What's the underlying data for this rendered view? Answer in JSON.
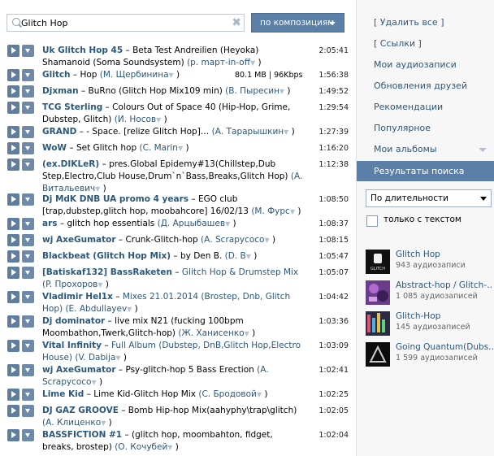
{
  "search": {
    "value": "Glitch Hop",
    "sort_label": "по композициям"
  },
  "tracks": [
    {
      "html": "<b>Uk Glitch Hop 45</b> – Beta Test Andreilien (Heyoka) Shamanoid (Soma Soundsystem) <span class=\"u\">(р. mapт-in-off</span><span class=\"dd\">▼</span> )",
      "dur": "2:05:41"
    },
    {
      "html": "<b>Glitch</b> – Hop <span class=\"u\">(М. Щербинина</span><span class=\"dd\">▼</span> )",
      "dur": "1:56:38",
      "meta": "80.1 MB | 96Kbps"
    },
    {
      "html": "<b>Djxman</b> – BuRno (Glitch Hop Mix109 min) <span class=\"u\">(В. Пыресин</span><span class=\"dd\">▼</span> )",
      "dur": "1:49:52"
    },
    {
      "html": "<b>TCG Sterling</b> – Colours Out of Space 40 (Hip-Hop, Grime, Dubstep, Glitch) <span class=\"u\">(И. Носов</span><span class=\"dd\">▼</span> )",
      "dur": "1:29:54"
    },
    {
      "html": "<b>GRAND</b> – - Space. [relize Glitch Hop]… <span class=\"u\">(А. Тарарышкин</span><span class=\"dd\">▼</span> )",
      "dur": "1:27:39"
    },
    {
      "html": "<b>WoW</b> – Set Glitch hop <span class=\"u\">(С. Marin</span><span class=\"dd\">▼</span> )",
      "dur": "1:16:20"
    },
    {
      "html": "<b>(ex.DIKLeR)</b> – pres.Global Epidemy#13(Chillstep,Dub Step,Electro,Club House,Drum`n`Bass,Breaks,Glitch Hop) <span class=\"u\">(А. Витальевич</span><span class=\"dd\">▼</span> )",
      "dur": "1:12:38"
    },
    {
      "html": "<b>Dj MdK DNB UA promo 4 years</b> – EGO club [trap,dubstep,glitch hop, moobahcore] 16/02/13 <span class=\"u\">(М. Фурс</span><span class=\"dd\">▼</span> )",
      "dur": "1:08:50"
    },
    {
      "html": "<b>ars</b> – glitch hop essentials <span class=\"u\">(Д. Арцыбашев</span><span class=\"dd\">▼</span> )",
      "dur": "1:08:37"
    },
    {
      "html": "<b>wj AxeGumator</b> – Crunk-Glitch-hop <span class=\"u\">(А. Scrapycoco</span><span class=\"dd\">▼</span> )",
      "dur": "1:08:15"
    },
    {
      "html": "<b>Blackbeat (Glitch Hop Mix)</b> – by Den B. <span class=\"u\">(D. B</span><span class=\"dd\">▼</span> )",
      "dur": "1:05:47"
    },
    {
      "html": "<b>[Batiskaf132] BassRaketen</b> – <span class=\"u\">Glitch Hop &amp; Drumstep Mix</span> <span class=\"u\">(P. Прохоров</span><span class=\"dd\">▼</span> )",
      "dur": "1:05:07"
    },
    {
      "html": "<b>Vladimir Hel1x</b> – <span class=\"u\">Mixes 21.01.2014 (Brostep, Dnb, Glitch Hop)</span> <span class=\"u\">(Е. Abdullayev</span><span class=\"dd\">▼</span> )",
      "dur": "1:04:42"
    },
    {
      "html": "<b>Dj dominator</b> – live mix N21 (fucking 100bpm Moombathon,Twerk,Glitch-hop) <span class=\"u\">(Ж. Ханисенко</span><span class=\"dd\">▼</span> )",
      "dur": "1:03:36"
    },
    {
      "html": "<b>Vital Infinity</b> – <span class=\"u\">Full Album (Dubstep, DnB,Glitch Hop,Electro House)</span> <span class=\"u\">(V. Dabija</span><span class=\"dd\">▼</span> )",
      "dur": "1:03:09"
    },
    {
      "html": "<b>wj AxeGumator</b> – Psy-glitch-hop 5 Bass Erection <span class=\"u\">(А. Scrapycoco</span><span class=\"dd\">▼</span> )",
      "dur": "1:02:41"
    },
    {
      "html": "<b>Lime Kid</b> – Lime Kid-Glitch Hop Mix <span class=\"u\">(С. Бродовой</span><span class=\"dd\">▼</span> )",
      "dur": "1:02:25"
    },
    {
      "html": "<b>DJ GAZ GROOVE</b> – Bomb Hip-hop Mix(aahyphy\\trap\\glitch) <span class=\"u\">(А. Клиценко</span><span class=\"dd\">▼</span> )",
      "dur": "1:02:05"
    },
    {
      "html": "<b>BASSFICTION #1</b> – (glitch hop, moombahton, fidget, breaks, brostep) <span class=\"u\">(О. Кочубей</span><span class=\"dd\">▼</span> )",
      "dur": "1:02:04"
    }
  ],
  "sidebar": {
    "links": [
      "[ Удалить все ]",
      "[ Ссылки ]",
      "Мои аудиозаписи",
      "Обновления друзей",
      "Рекомендации",
      "Популярное",
      "Мои альбомы"
    ],
    "selected": "Результаты поиска",
    "sort_option": "По длительности",
    "only_text_label": "только с текстом",
    "groups": [
      {
        "name": "Glitch Hop",
        "count": "943 аудиозаписи"
      },
      {
        "name": "Abstract-hop / Glitch-…",
        "count": "1 085 аудиозаписей"
      },
      {
        "name": "Glitch-Hop",
        "count": "145 аудиозаписей"
      },
      {
        "name": "Going Quantum(Dubs…",
        "count": "1 599 аудиозаписей"
      }
    ]
  }
}
